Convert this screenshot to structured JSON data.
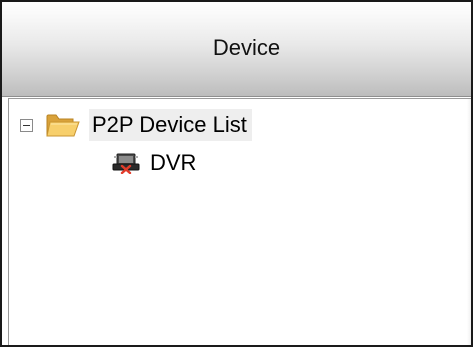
{
  "header": {
    "title": "Device"
  },
  "tree": {
    "root": {
      "label": "P2P Device List",
      "expanded": true,
      "icon": "folder-open-icon",
      "children": [
        {
          "label": "DVR",
          "icon": "dvr-device-icon"
        }
      ]
    }
  },
  "colors": {
    "header_top": "#ffffff",
    "header_bottom": "#bdbdbd",
    "folder": "#f2c35c",
    "border": "#1a1a1a"
  }
}
